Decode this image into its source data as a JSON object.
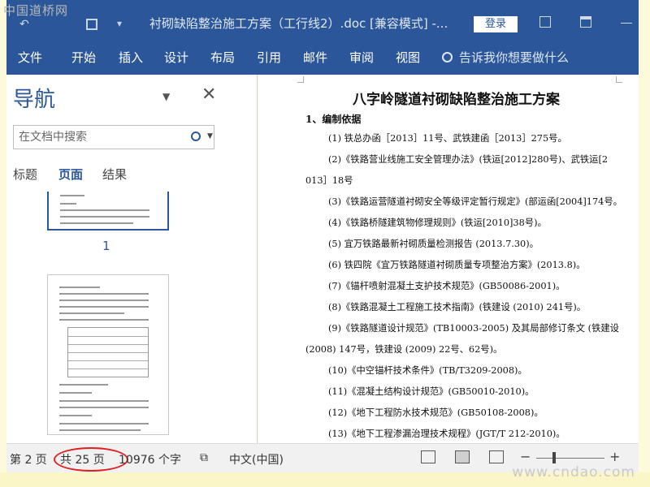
{
  "watermark": {
    "top": "中国道桥网",
    "bottom": "www.cndao.com"
  },
  "titlebar": {
    "title": "衬砌缺陷整治施工方案（工行线2）.doc [兼容模式] -...",
    "login_label": "登录"
  },
  "ribbon": {
    "tabs": [
      "文件",
      "开始",
      "插入",
      "设计",
      "布局",
      "引用",
      "邮件",
      "审阅",
      "视图"
    ],
    "tell_me": "告诉我你想要做什么"
  },
  "nav": {
    "title": "导航",
    "search_placeholder": "在文档中搜索",
    "tabs": [
      "标题",
      "页面",
      "结果"
    ],
    "active_tab": "页面",
    "thumb_page_number": "1"
  },
  "document": {
    "title": "八字岭隧道衬砌缺陷整治施工方案",
    "section": "1、编制依据",
    "lines": [
      {
        "text": "(1) 铁总办函［2013］11号、武铁建函［2013］275号。",
        "indent": true
      },
      {
        "text": "(2)《铁路营业线施工安全管理办法》(铁运[2012]280号)、武铁运[2",
        "indent": true
      },
      {
        "text": "013］18号",
        "indent": false
      },
      {
        "text": "(3)《铁路运营隧道衬砌安全等级评定暂行规定》(部运函[2004]174号。",
        "indent": true
      },
      {
        "text": "(4)《铁路桥隧建筑物修理规则》(铁运[2010]38号)。",
        "indent": true
      },
      {
        "text": "(5) 宜万铁路最新衬砌质量检测报告 (2013.7.30)。",
        "indent": true
      },
      {
        "text": "(6) 铁四院《宜万铁路隧道衬砌质量专项整治方案》(2013.8)。",
        "indent": true
      },
      {
        "text": "(7)《锚杆喷射混凝土支护技术规范》(GB50086-2001)。",
        "indent": true
      },
      {
        "text": "(8)《铁路混凝土工程施工技术指南》(铁建设 (2010) 241号)。",
        "indent": true
      },
      {
        "text": "(9)《铁路隧道设计规范》(TB10003-2005) 及其局部修订条文 (铁建设",
        "indent": true
      },
      {
        "text": "(2008) 147号，铁建设 (2009) 22号、62号)。",
        "indent": false
      },
      {
        "text": "(10)《中空锚杆技术条件》(TB/T3209-2008)。",
        "indent": true
      },
      {
        "text": "(11)《混凝土结构设计规范》(GB50010-2010)。",
        "indent": true
      },
      {
        "text": "(12)《地下工程防水技术规范》(GB50108-2008)。",
        "indent": true
      },
      {
        "text": "(13)《地下工程渗漏治理技术规程》(JGT/T 212-2010)。",
        "indent": true
      }
    ]
  },
  "status": {
    "page": "第 2 页",
    "total": "共 25 页",
    "words": "10976 个字",
    "language": "中文(中国)",
    "circle_color": "#e02020"
  },
  "colors": {
    "brand": "#2b579a"
  }
}
